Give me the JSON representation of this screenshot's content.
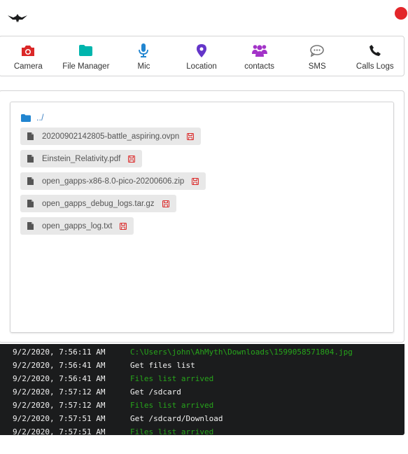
{
  "colors": {
    "camera": "#db2828",
    "file_manager": "#00b5ad",
    "mic": "#2185d0",
    "location": "#6435c9",
    "contacts": "#a333c8",
    "sms": "#767676",
    "calls": "#1b1c1d",
    "status_dot": "#e3262a",
    "folder": "#2185d0",
    "log_success": "#27a51b"
  },
  "nav": [
    {
      "label": "Camera",
      "icon": "camera-icon"
    },
    {
      "label": "File Manager",
      "icon": "folder-icon"
    },
    {
      "label": "Mic",
      "icon": "microphone-icon"
    },
    {
      "label": "Location",
      "icon": "map-marker-icon"
    },
    {
      "label": "contacts",
      "icon": "users-icon"
    },
    {
      "label": "SMS",
      "icon": "comment-icon"
    },
    {
      "label": "Calls Logs",
      "icon": "phone-icon"
    }
  ],
  "file_manager": {
    "parent_dir": "../",
    "files": [
      {
        "name": "20200902142805-battle_aspiring.ovpn"
      },
      {
        "name": "Einstein_Relativity.pdf"
      },
      {
        "name": "open_gapps-x86-8.0-pico-20200606.zip"
      },
      {
        "name": "open_gapps_debug_logs.tar.gz"
      },
      {
        "name": "open_gapps_log.txt"
      }
    ]
  },
  "log": [
    {
      "time": "9/2/2020, 7:56:11 AM",
      "message": "C:\\Users\\john\\AhMyth\\Downloads\\1599058571804.jpg",
      "success": true
    },
    {
      "time": "9/2/2020, 7:56:41 AM",
      "message": "Get files list",
      "success": false
    },
    {
      "time": "9/2/2020, 7:56:41 AM",
      "message": "Files list arrived",
      "success": true
    },
    {
      "time": "9/2/2020, 7:57:12 AM",
      "message": "Get /sdcard",
      "success": false
    },
    {
      "time": "9/2/2020, 7:57:12 AM",
      "message": "Files list arrived",
      "success": true
    },
    {
      "time": "9/2/2020, 7:57:51 AM",
      "message": "Get /sdcard/Download",
      "success": false
    },
    {
      "time": "9/2/2020, 7:57:51 AM",
      "message": "Files list arrived",
      "success": true
    }
  ]
}
